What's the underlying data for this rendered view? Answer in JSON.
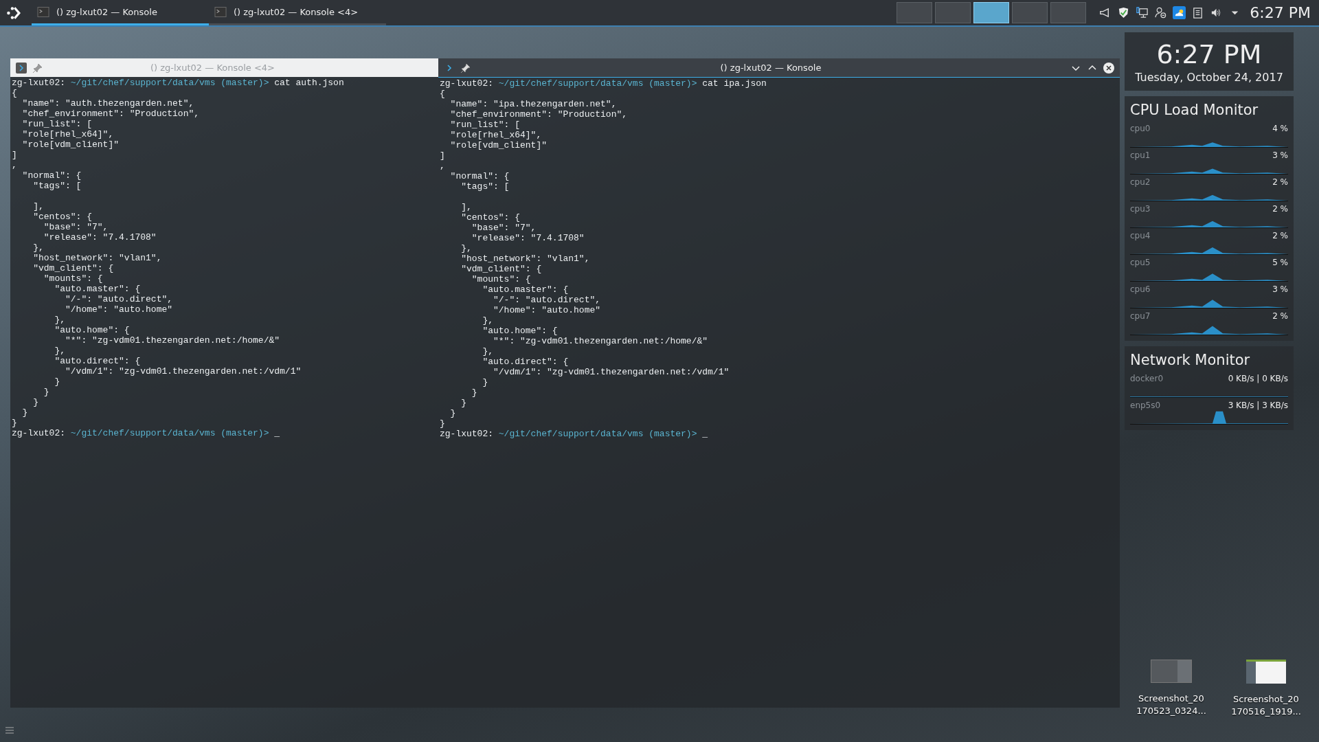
{
  "panel": {
    "tasks": [
      {
        "title": "() zg-lxut02 — Konsole",
        "selected": true
      },
      {
        "title": "() zg-lxut02 — Konsole <4>",
        "selected": false
      }
    ],
    "pager": [
      {
        "selected": false
      },
      {
        "selected": false
      },
      {
        "selected": true
      },
      {
        "selected": false
      },
      {
        "selected": false
      }
    ],
    "tray": [
      {
        "kind": "notifications"
      },
      {
        "kind": "shield"
      },
      {
        "kind": "network"
      },
      {
        "kind": "user"
      },
      {
        "kind": "weather"
      },
      {
        "kind": "clipboard"
      },
      {
        "kind": "volume"
      },
      {
        "kind": "expand"
      }
    ],
    "clock": "6:27 PM"
  },
  "windows": [
    {
      "title": "() zg-lxut02 — Konsole <4>",
      "active": false,
      "lines": [
        {
          "kind": "prompt",
          "host": "zg-lxut02:",
          "path": "~/git/chef/support/data/vms",
          "branch": "(master)>",
          "command": "cat auth.json"
        },
        {
          "kind": "text",
          "text": "{"
        },
        {
          "kind": "text",
          "text": "  \"name\": \"auth.thezengarden.net\","
        },
        {
          "kind": "text",
          "text": "  \"chef_environment\": \"Production\","
        },
        {
          "kind": "text",
          "text": "  \"run_list\": ["
        },
        {
          "kind": "text",
          "text": "  \"role[rhel_x64]\","
        },
        {
          "kind": "text",
          "text": "  \"role[vdm_client]\""
        },
        {
          "kind": "text",
          "text": "]"
        },
        {
          "kind": "text",
          "text": ","
        },
        {
          "kind": "text",
          "text": "  \"normal\": {"
        },
        {
          "kind": "text",
          "text": "    \"tags\": ["
        },
        {
          "kind": "blank"
        },
        {
          "kind": "text",
          "text": "    ],"
        },
        {
          "kind": "text",
          "text": "    \"centos\": {"
        },
        {
          "kind": "text",
          "text": "      \"base\": \"7\","
        },
        {
          "kind": "text",
          "text": "      \"release\": \"7.4.1708\""
        },
        {
          "kind": "text",
          "text": "    },"
        },
        {
          "kind": "text",
          "text": "    \"host_network\": \"vlan1\","
        },
        {
          "kind": "text",
          "text": "    \"vdm_client\": {"
        },
        {
          "kind": "text",
          "text": "      \"mounts\": {"
        },
        {
          "kind": "text",
          "text": "        \"auto.master\": {"
        },
        {
          "kind": "text",
          "text": "          \"/-\": \"auto.direct\","
        },
        {
          "kind": "text",
          "text": "          \"/home\": \"auto.home\""
        },
        {
          "kind": "text",
          "text": "        },"
        },
        {
          "kind": "text",
          "text": "        \"auto.home\": {"
        },
        {
          "kind": "text",
          "text": "          \"*\": \"zg-vdm01.thezengarden.net:/home/&\""
        },
        {
          "kind": "text",
          "text": "        },"
        },
        {
          "kind": "text",
          "text": "        \"auto.direct\": {"
        },
        {
          "kind": "text",
          "text": "          \"/vdm/1\": \"zg-vdm01.thezengarden.net:/vdm/1\""
        },
        {
          "kind": "text",
          "text": "        }"
        },
        {
          "kind": "text",
          "text": "      }"
        },
        {
          "kind": "text",
          "text": "    }"
        },
        {
          "kind": "text",
          "text": "  }"
        },
        {
          "kind": "text",
          "text": "}"
        },
        {
          "kind": "prompt",
          "host": "zg-lxut02:",
          "path": "~/git/chef/support/data/vms",
          "branch": "(master)>",
          "command": "_"
        }
      ]
    },
    {
      "title": "() zg-lxut02 — Konsole",
      "active": true,
      "lines": [
        {
          "kind": "prompt",
          "host": "zg-lxut02:",
          "path": "~/git/chef/support/data/vms",
          "branch": "(master)>",
          "command": "cat ipa.json"
        },
        {
          "kind": "text",
          "text": "{"
        },
        {
          "kind": "text",
          "text": "  \"name\": \"ipa.thezengarden.net\","
        },
        {
          "kind": "text",
          "text": "  \"chef_environment\": \"Production\","
        },
        {
          "kind": "text",
          "text": "  \"run_list\": ["
        },
        {
          "kind": "text",
          "text": "  \"role[rhel_x64]\","
        },
        {
          "kind": "text",
          "text": "  \"role[vdm_client]\""
        },
        {
          "kind": "text",
          "text": "]"
        },
        {
          "kind": "text",
          "text": ","
        },
        {
          "kind": "text",
          "text": "  \"normal\": {"
        },
        {
          "kind": "text",
          "text": "    \"tags\": ["
        },
        {
          "kind": "blank"
        },
        {
          "kind": "text",
          "text": "    ],"
        },
        {
          "kind": "text",
          "text": "    \"centos\": {"
        },
        {
          "kind": "text",
          "text": "      \"base\": \"7\","
        },
        {
          "kind": "text",
          "text": "      \"release\": \"7.4.1708\""
        },
        {
          "kind": "text",
          "text": "    },"
        },
        {
          "kind": "text",
          "text": "    \"host_network\": \"vlan1\","
        },
        {
          "kind": "text",
          "text": "    \"vdm_client\": {"
        },
        {
          "kind": "text",
          "text": "      \"mounts\": {"
        },
        {
          "kind": "text",
          "text": "        \"auto.master\": {"
        },
        {
          "kind": "text",
          "text": "          \"/-\": \"auto.direct\","
        },
        {
          "kind": "text",
          "text": "          \"/home\": \"auto.home\""
        },
        {
          "kind": "text",
          "text": "        },"
        },
        {
          "kind": "text",
          "text": "        \"auto.home\": {"
        },
        {
          "kind": "text",
          "text": "          \"*\": \"zg-vdm01.thezengarden.net:/home/&\""
        },
        {
          "kind": "text",
          "text": "        },"
        },
        {
          "kind": "text",
          "text": "        \"auto.direct\": {"
        },
        {
          "kind": "text",
          "text": "          \"/vdm/1\": \"zg-vdm01.thezengarden.net:/vdm/1\""
        },
        {
          "kind": "text",
          "text": "        }"
        },
        {
          "kind": "text",
          "text": "      }"
        },
        {
          "kind": "text",
          "text": "    }"
        },
        {
          "kind": "text",
          "text": "  }"
        },
        {
          "kind": "text",
          "text": "}"
        },
        {
          "kind": "prompt",
          "host": "zg-lxut02:",
          "path": "~/git/chef/support/data/vms",
          "branch": "(master)>",
          "command": "_"
        }
      ]
    }
  ],
  "clock_widget": {
    "time": "6:27 PM",
    "date": "Tuesday, October 24, 2017"
  },
  "cpu_monitor": {
    "title": "CPU Load Monitor",
    "cpus": [
      {
        "name": "cpu0",
        "reading": "4 %"
      },
      {
        "name": "cpu1",
        "reading": "3 %"
      },
      {
        "name": "cpu2",
        "reading": "2 %"
      },
      {
        "name": "cpu3",
        "reading": "2 %"
      },
      {
        "name": "cpu4",
        "reading": "2 %"
      },
      {
        "name": "cpu5",
        "reading": "5 %"
      },
      {
        "name": "cpu6",
        "reading": "3 %"
      },
      {
        "name": "cpu7",
        "reading": "2 %"
      }
    ]
  },
  "network_monitor": {
    "title": "Network Monitor",
    "interfaces": [
      {
        "name": "docker0",
        "reading": "0 KB/s | 0 KB/s"
      },
      {
        "name": "enp5s0",
        "reading": "3 KB/s | 3 KB/s"
      }
    ]
  },
  "desktop_icons": [
    {
      "label_lines": [
        "Screenshot_20",
        "170523_0324..."
      ],
      "kind": "dark"
    },
    {
      "label_lines": [
        "Screenshot_20",
        "170516_1919..."
      ],
      "kind": "light"
    }
  ]
}
